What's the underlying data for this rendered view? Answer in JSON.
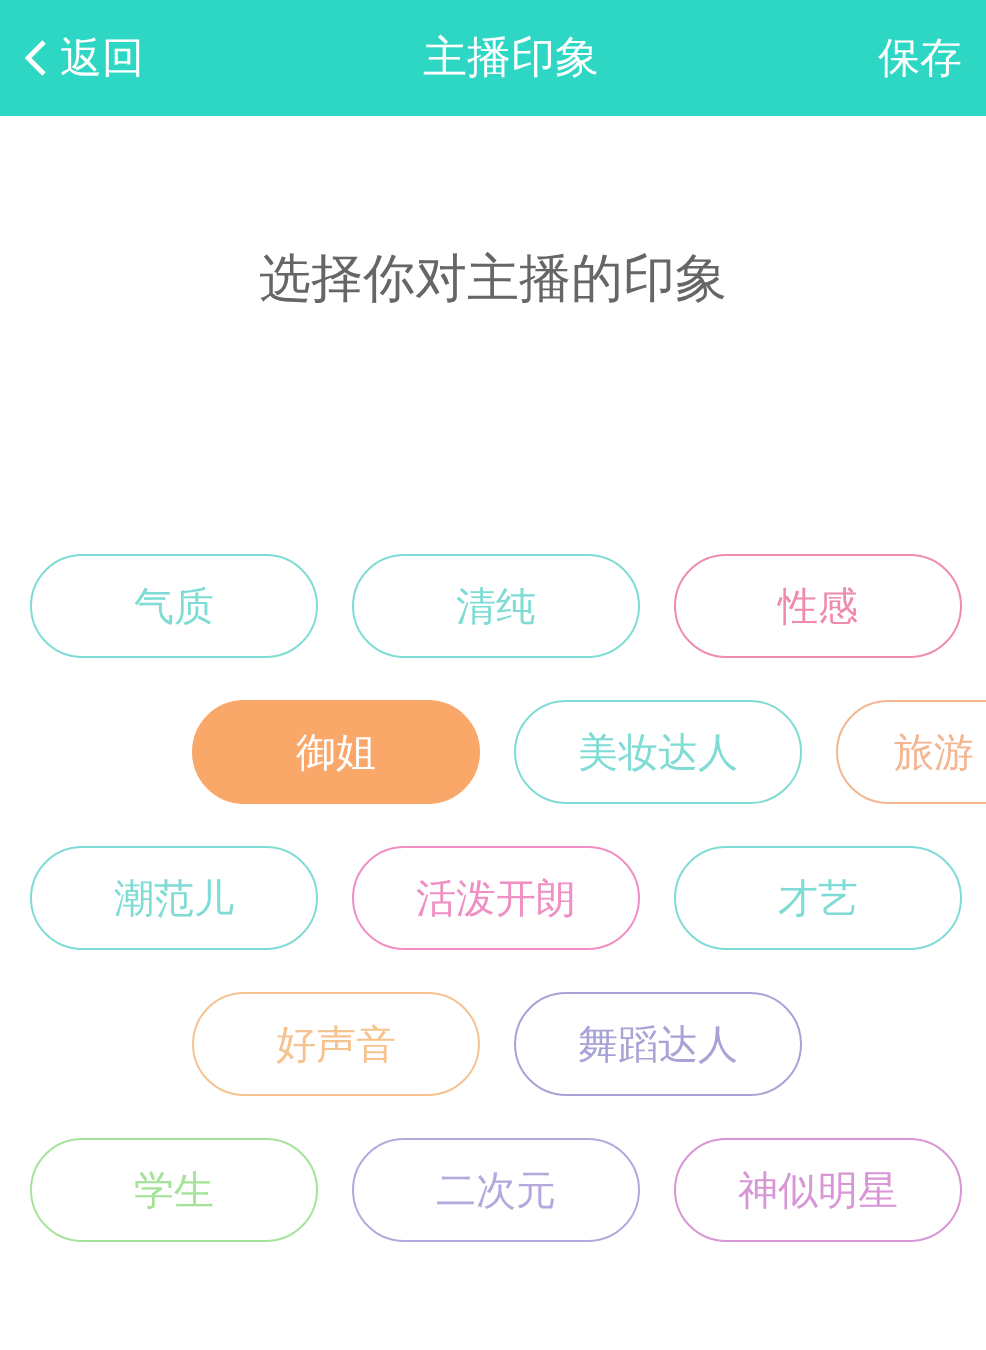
{
  "header": {
    "back": "返回",
    "title": "主播印象",
    "save": "保存"
  },
  "prompt": "选择你对主播的印象",
  "rows": [
    {
      "tags": [
        {
          "label": "气质",
          "color": "#7fdcd4",
          "selected": false
        },
        {
          "label": "清纯",
          "color": "#7fdcd4",
          "selected": false
        },
        {
          "label": "性感",
          "color": "#f08cab",
          "selected": false
        }
      ]
    },
    {
      "tags": [
        {
          "label": "御姐",
          "color": "#f9a86a",
          "selected": true
        },
        {
          "label": "美妆达人",
          "color": "#7fdcd4",
          "selected": false
        },
        {
          "label": "旅游",
          "color": "#f5b58f",
          "selected": false
        }
      ]
    },
    {
      "tags": [
        {
          "label": "潮范儿",
          "color": "#7fdcd4",
          "selected": false
        },
        {
          "label": "活泼开朗",
          "color": "#ef8fc4",
          "selected": false
        },
        {
          "label": "才艺",
          "color": "#7fdcd4",
          "selected": false
        }
      ]
    },
    {
      "tags": [
        {
          "label": "好声音",
          "color": "#f6c28f",
          "selected": false
        },
        {
          "label": "舞蹈达人",
          "color": "#a7a3d6",
          "selected": false
        }
      ]
    },
    {
      "tags": [
        {
          "label": "学生",
          "color": "#a6e39a",
          "selected": false
        },
        {
          "label": "二次元",
          "color": "#b4a8dc",
          "selected": false
        },
        {
          "label": "神似明星",
          "color": "#d996d6",
          "selected": false
        }
      ]
    }
  ]
}
